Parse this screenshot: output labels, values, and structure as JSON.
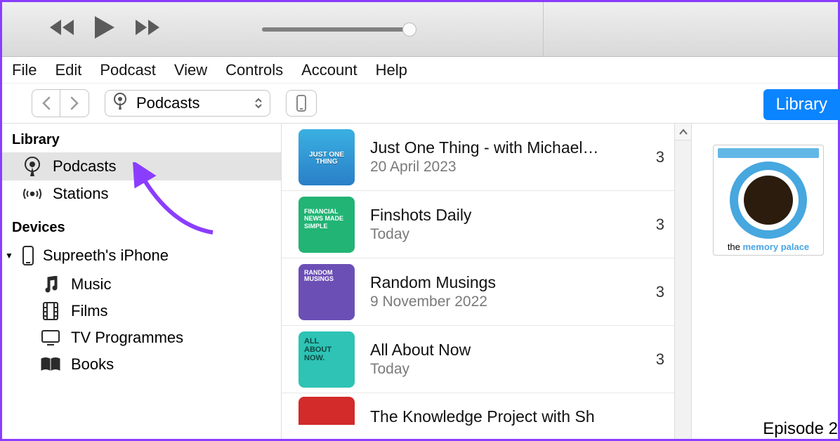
{
  "menu": {
    "items": [
      "File",
      "Edit",
      "Podcast",
      "View",
      "Controls",
      "Account",
      "Help"
    ]
  },
  "toolbar": {
    "section_label": "Podcasts",
    "library_button": "Library"
  },
  "sidebar": {
    "library_heading": "Library",
    "library_items": [
      {
        "label": "Podcasts",
        "selected": true,
        "icon": "podcast"
      },
      {
        "label": "Stations",
        "selected": false,
        "icon": "stations"
      }
    ],
    "devices_heading": "Devices",
    "device": {
      "label": "Supreeth's iPhone"
    },
    "device_children": [
      {
        "label": "Music",
        "icon": "music"
      },
      {
        "label": "Films",
        "icon": "films"
      },
      {
        "label": "TV Programmes",
        "icon": "tv"
      },
      {
        "label": "Books",
        "icon": "books"
      }
    ]
  },
  "podcasts": [
    {
      "title": "Just One Thing - with Michael…",
      "subtitle": "20 April 2023",
      "count": "3",
      "art": "art-blue"
    },
    {
      "title": "Finshots Daily",
      "subtitle": "Today",
      "count": "3",
      "art": "art-green"
    },
    {
      "title": "Random Musings",
      "subtitle": "9 November 2022",
      "count": "3",
      "art": "art-purple"
    },
    {
      "title": "All About Now",
      "subtitle": "Today",
      "count": "3",
      "art": "art-teal"
    },
    {
      "title": "The Knowledge Project with Sh",
      "subtitle": "",
      "count": "",
      "art": "art-red"
    }
  ],
  "detail": {
    "artwork_label_prefix": "the ",
    "artwork_label_strong": "memory palace",
    "episode_line": "Episode 2"
  }
}
